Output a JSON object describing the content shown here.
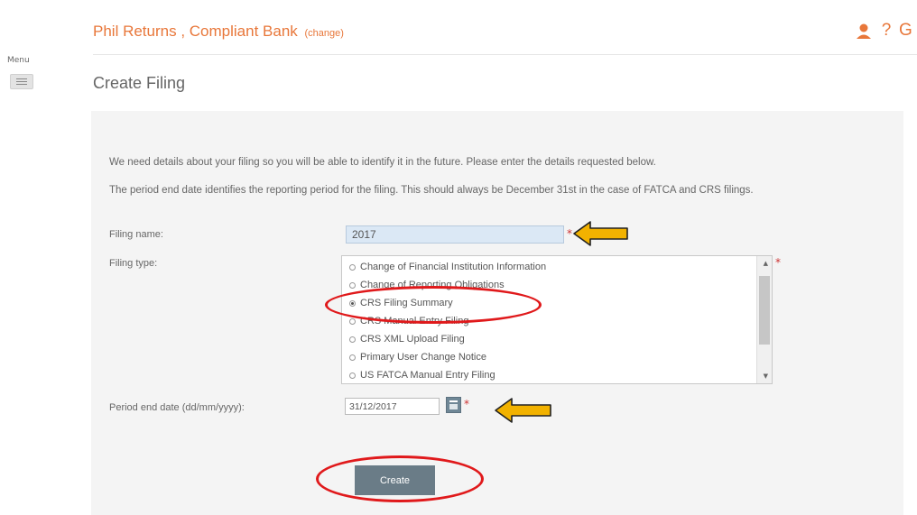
{
  "menu": {
    "label": "Menu"
  },
  "header": {
    "title": "Phil Returns , Compliant Bank",
    "change_link": "(change)",
    "help_glyph": "?",
    "logout_glyph": "G",
    "icons": [
      "user-icon",
      "help-icon",
      "logout-icon"
    ],
    "accent_color": "#e8773a"
  },
  "page": {
    "title": "Create Filing"
  },
  "intro": {
    "line1": "We need details about your filing so you will be able to identify it in the future. Please enter the details requested below.",
    "line2": "The period end date identifies the reporting period for the filing. This should always be December 31st in the case of FATCA and CRS filings."
  },
  "form": {
    "filing_name_label": "Filing name:",
    "filing_name_value": "2017",
    "filing_type_label": "Filing type:",
    "filing_type_options": [
      "Change of Financial Institution Information",
      "Change of Reporting Obligations",
      "CRS Filing Summary",
      "CRS Manual Entry Filing",
      "CRS XML Upload Filing",
      "Primary User Change Notice",
      "US FATCA Manual Entry Filing"
    ],
    "filing_type_selected": "CRS Filing Summary",
    "period_end_label": "Period end date (dd/mm/yyyy):",
    "period_end_value": "31/12/2017",
    "required_marker": "*",
    "create_label": "Create"
  },
  "annotations": {
    "ellipse_color": "#e0191b",
    "arrow_color": "#f2b200"
  }
}
